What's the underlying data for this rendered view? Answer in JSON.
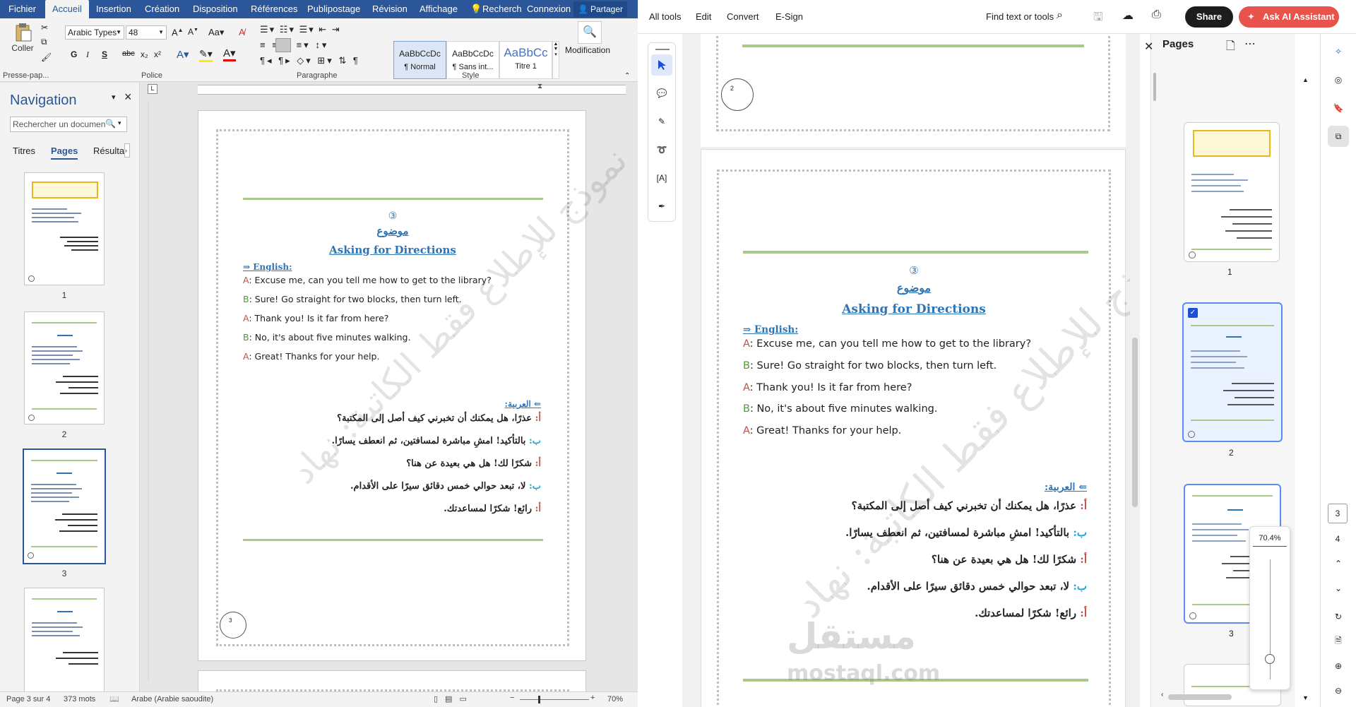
{
  "word": {
    "tabs": [
      "Fichier",
      "Accueil",
      "Insertion",
      "Création",
      "Disposition",
      "Références",
      "Publipostage",
      "Révision",
      "Affichage",
      "Recherch",
      "Connexion"
    ],
    "share": "Partager",
    "ribbon": {
      "paste": "Coller",
      "clipboard": "Presse-pap...",
      "font_name": "Arabic Types",
      "font_size": "48",
      "bold": "G",
      "italic": "I",
      "underline": "S",
      "strike": "abc",
      "sub": "x₂",
      "sup": "x²",
      "police": "Police",
      "paragraphe": "Paragraphe",
      "style_group": "Style",
      "modification": "Modification",
      "styles": [
        {
          "sample": "AaBbCcDc",
          "name": "¶ Normal"
        },
        {
          "sample": "AaBbCcDc",
          "name": "¶ Sans int..."
        },
        {
          "sample": "AaBbCc",
          "name": "Titre 1"
        }
      ]
    },
    "nav": {
      "title": "Navigation",
      "search_placeholder": "Rechercher un documen",
      "tabs": [
        "Titres",
        "Pages",
        "Résultat"
      ],
      "thumbs": [
        "1",
        "2",
        "3"
      ]
    },
    "status": {
      "page": "Page 3 sur 4",
      "words": "373 mots",
      "lang": "Arabe (Arabie saoudite)",
      "zoom": "70%"
    }
  },
  "doc": {
    "num": "③",
    "subject": "موضوع",
    "title": "Asking for Directions",
    "english_label": "⇒ English:",
    "lines": [
      {
        "sp": "A",
        "text": ": Excuse me, can you tell me how to get to the library?"
      },
      {
        "sp": "B",
        "text": ": Sure! Go straight for two blocks, then turn left."
      },
      {
        "sp": "A",
        "text": ": Thank you! Is it far from here?"
      },
      {
        "sp": "B",
        "text": ": No, it's about five minutes walking."
      },
      {
        "sp": "A",
        "text": ": Great! Thanks for your help."
      }
    ],
    "arabic_label": "⇐ العربية:",
    "arabic": [
      {
        "sp": "أ:",
        "text": "عذرًا، هل يمكنك أن تخبرني كيف أصل إلى المكتبة؟"
      },
      {
        "sp": "ب:",
        "text": "بالتأكيد! امشِ مباشرة لمسافتين، ثم انعطف يسارًا."
      },
      {
        "sp": "أ:",
        "text": "شكرًا لك! هل هي بعيدة عن هنا؟"
      },
      {
        "sp": "ب:",
        "text": "لا، تبعد حوالي خمس دقائق سيرًا على الأقدام."
      },
      {
        "sp": "أ:",
        "text": "رائع! شكرًا لمساعدتك."
      }
    ],
    "watermark": "نموذج للإطلاع فقط الكاتبة: نهاد",
    "page_circle_word": "3",
    "page_circle_prev": "2"
  },
  "acrobat": {
    "menu": [
      "All tools",
      "Edit",
      "Convert",
      "E-Sign"
    ],
    "find": "Find text or tools",
    "share": "Share",
    "ai": "Ask AI Assistant",
    "panel_title": "Pages",
    "thumbs": [
      "1",
      "2",
      "3"
    ],
    "page_nums": [
      "3",
      "4"
    ],
    "zoom": "70.4%",
    "logo": "مستقل",
    "logo_url": "mostaql.com"
  }
}
